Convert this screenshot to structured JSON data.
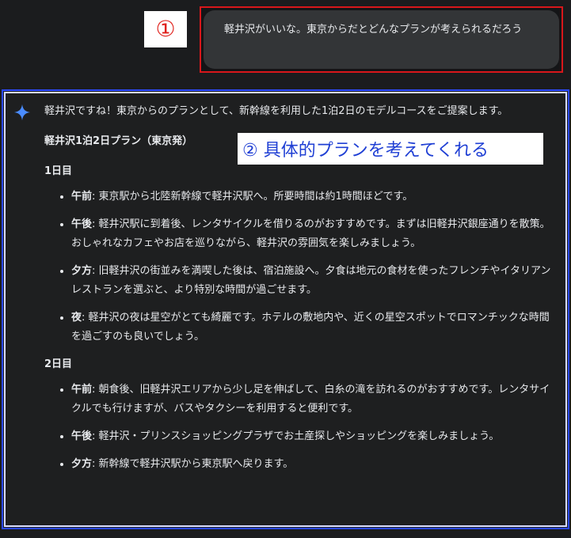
{
  "annotations": {
    "marker1": "①",
    "marker2": "② 具体的プランを考えてくれる"
  },
  "user_message": "軽井沢がいいな。東京からだとどんなプランが考えられるだろう",
  "response": {
    "intro": "軽井沢ですね！東京からのプランとして、新幹線を利用した1泊2日のモデルコースをご提案します。",
    "plan_title": "軽井沢1泊2日プラン（東京発）",
    "days": [
      {
        "label": "1日目",
        "items": [
          {
            "time": "午前",
            "text": ": 東京駅から北陸新幹線で軽井沢駅へ。所要時間は約1時間ほどです。"
          },
          {
            "time": "午後",
            "text": ": 軽井沢駅に到着後、レンタサイクルを借りるのがおすすめです。まずは旧軽井沢銀座通りを散策。おしゃれなカフェやお店を巡りながら、軽井沢の雰囲気を楽しみましょう。"
          },
          {
            "time": "夕方",
            "text": ": 旧軽井沢の街並みを満喫した後は、宿泊施設へ。夕食は地元の食材を使ったフレンチやイタリアンレストランを選ぶと、より特別な時間が過ごせます。"
          },
          {
            "time": "夜",
            "text": ": 軽井沢の夜は星空がとても綺麗です。ホテルの敷地内や、近くの星空スポットでロマンチックな時間を過ごすのも良いでしょう。"
          }
        ]
      },
      {
        "label": "2日目",
        "items": [
          {
            "time": "午前",
            "text": ": 朝食後、旧軽井沢エリアから少し足を伸ばして、白糸の滝を訪れるのがおすすめです。レンタサイクルでも行けますが、バスやタクシーを利用すると便利です。"
          },
          {
            "time": "午後",
            "text": ": 軽井沢・プリンスショッピングプラザでお土産探しやショッピングを楽しみましょう。"
          },
          {
            "time": "夕方",
            "text": ": 新幹線で軽井沢駅から東京駅へ戻ります。"
          }
        ]
      }
    ]
  },
  "colors": {
    "background": "#1b1c1e",
    "user_bubble": "#333537",
    "red_frame": "#d8171b",
    "blue_frame": "#2b49ff",
    "callout_text": "#1f3fd4",
    "spark": "#4a8cff"
  },
  "icons": {
    "response": "gemini-spark-icon"
  }
}
